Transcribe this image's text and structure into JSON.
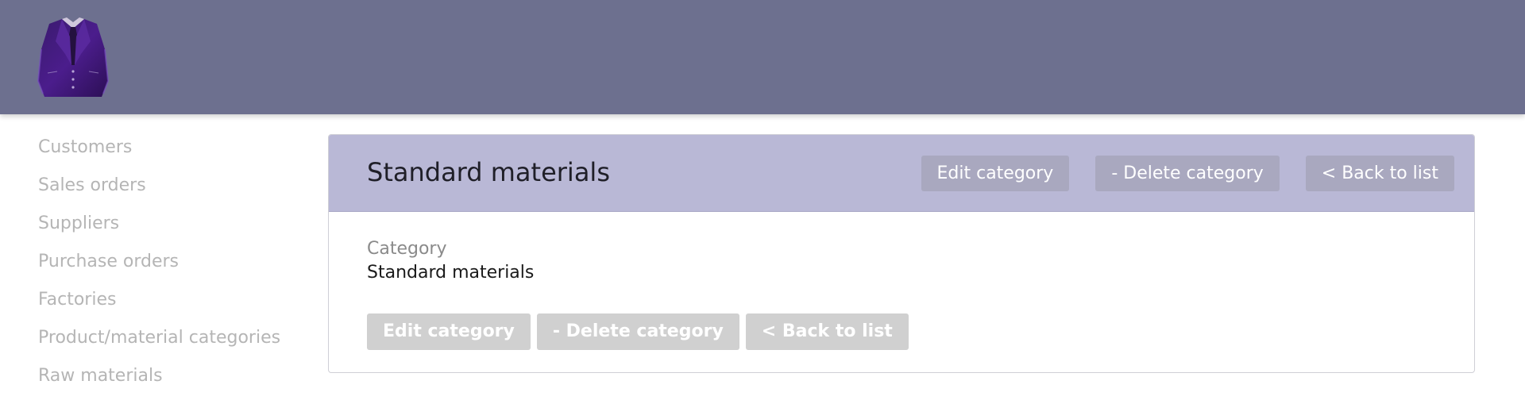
{
  "header": {
    "logo_icon": "suit-jacket-icon",
    "background_color": "#6d708f"
  },
  "sidebar": {
    "items": [
      {
        "label": "Customers"
      },
      {
        "label": "Sales orders"
      },
      {
        "label": "Suppliers"
      },
      {
        "label": "Purchase orders"
      },
      {
        "label": "Factories"
      },
      {
        "label": "Product/material categories"
      },
      {
        "label": "Raw materials"
      }
    ]
  },
  "panel": {
    "title": "Standard materials",
    "header_actions": {
      "edit": "Edit category",
      "delete": "- Delete category",
      "back": "< Back to list"
    },
    "field": {
      "label": "Category",
      "value": "Standard materials"
    },
    "body_actions": {
      "edit": "Edit category",
      "delete": "- Delete category",
      "back": "< Back to list"
    },
    "header_color": "#b9b8d6"
  }
}
